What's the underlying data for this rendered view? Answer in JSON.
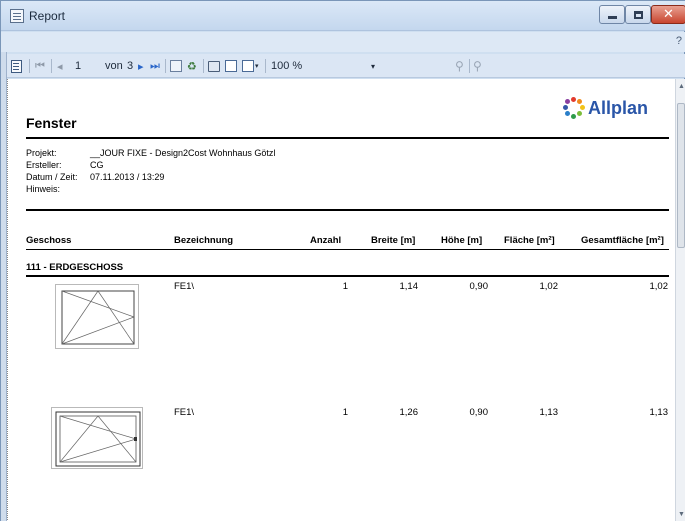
{
  "window": {
    "title": "Report",
    "help": "?"
  },
  "toolbar": {
    "page_current": "1",
    "page_of_label": "von",
    "page_total": "3",
    "zoom": "100 %"
  },
  "report": {
    "title": "Fenster",
    "logo_text": "Allplan",
    "meta": [
      {
        "key": "Projekt:",
        "value": "__JOUR FIXE - Design2Cost Wohnhaus Götzl"
      },
      {
        "key": "Ersteller:",
        "value": "CG"
      },
      {
        "key": "Datum / Zeit:",
        "value": "07.11.2013  /  13:29"
      },
      {
        "key": "Hinweis:",
        "value": ""
      }
    ],
    "columns": [
      "Geschoss",
      "Bezeichnung",
      "Anzahl",
      "Breite [m]",
      "Höhe [m]",
      "Fläche [m²]",
      "Gesamtfläche [m²]"
    ],
    "group": "111 - ERDGESCHOSS",
    "rows": [
      {
        "bezeichnung": "FE1\\",
        "anzahl": "1",
        "breite": "1,14",
        "hoehe": "0,90",
        "flaeche": "1,02",
        "gesamt": "1,02"
      },
      {
        "bezeichnung": "FE1\\",
        "anzahl": "1",
        "breite": "1,26",
        "hoehe": "0,90",
        "flaeche": "1,13",
        "gesamt": "1,13"
      }
    ]
  },
  "colors": {
    "title_bar": "#c4d7ee",
    "close_button": "#c8452f",
    "logo_blue": "#2a56a8"
  }
}
